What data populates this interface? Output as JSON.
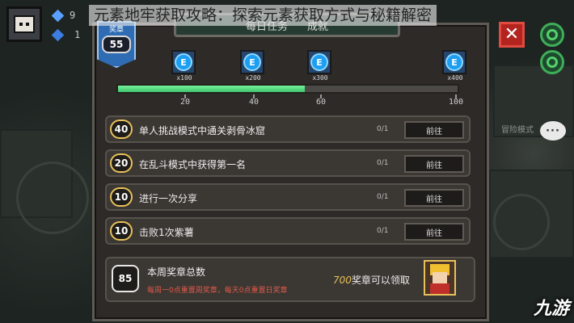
{
  "watermark_title": "元素地牢获取攻略：探索元素获取方式与秘籍解密",
  "hud": {
    "gem_count_1": "9",
    "gem_count_2": "1"
  },
  "panel": {
    "header_left": "每日任务",
    "header_right": "成就",
    "rank": {
      "label": "奖章",
      "value": "55"
    }
  },
  "rewards": [
    {
      "icon": "element-coin-icon",
      "glyph": "E",
      "qty": "x100"
    },
    {
      "icon": "element-coin-icon",
      "glyph": "E",
      "qty": "x200"
    },
    {
      "icon": "element-coin-icon",
      "glyph": "E",
      "qty": "x300"
    },
    {
      "icon": "element-coin-icon",
      "glyph": "E",
      "qty": "x400"
    }
  ],
  "progress": {
    "value": 55,
    "max": 100,
    "ticks": [
      "20",
      "40",
      "60",
      "100"
    ]
  },
  "tasks": [
    {
      "points": "40",
      "desc": "单人挑战模式中通关剥骨冰窟",
      "progress": "0/1",
      "button": "前往"
    },
    {
      "points": "20",
      "desc": "在乱斗模式中获得第一名",
      "progress": "0/1",
      "button": "前往"
    },
    {
      "points": "10",
      "desc": "进行一次分享",
      "progress": "0/1",
      "button": "前往"
    },
    {
      "points": "10",
      "desc": "击败1次紫薯",
      "progress": "0/1",
      "button": "前往"
    }
  ],
  "weekly": {
    "total": "85",
    "title": "本周奖章总数",
    "note": "每周一0点重置周奖章，每天0点重置日奖章",
    "claim_amount": "700",
    "claim_text": "奖章可以领取"
  },
  "side": {
    "label": "冒险模式"
  },
  "chat_icon_text": "···",
  "close_glyph": "✕",
  "logo_text": "九游",
  "colors": {
    "accent_gold": "#e8c15a",
    "progress_green": "#4fd97a",
    "close_red": "#b3241f",
    "coin_blue": "#1d9ef0"
  }
}
